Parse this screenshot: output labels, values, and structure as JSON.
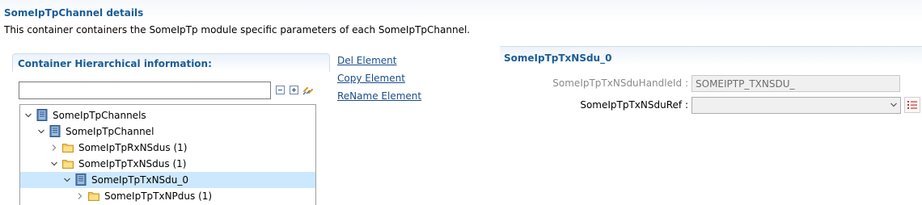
{
  "page": {
    "title": "SomeIpTpChannel details",
    "description": "This container containers the SomeIpTp module specific parameters of each SomeIpTpChannel."
  },
  "hierarchy": {
    "title": "Container Hierarchical information:",
    "filter_value": "",
    "tools": [
      "collapse-all-icon",
      "expand-all-icon",
      "link-with-editor-icon"
    ]
  },
  "tree": [
    {
      "label": "SomeIpTpChannels",
      "icon": "container-icon",
      "expanded": true,
      "level": 0
    },
    {
      "label": "SomeIpTpChannel",
      "icon": "container-icon",
      "expanded": true,
      "level": 1
    },
    {
      "label": "SomeIpTpRxNSdus (1)",
      "icon": "folder-icon",
      "expanded": false,
      "level": 2
    },
    {
      "label": "SomeIpTpTxNSdus (1)",
      "icon": "folder-icon",
      "expanded": true,
      "level": 2
    },
    {
      "label": "SomeIpTpTxNSdu_0",
      "icon": "container-icon",
      "expanded": true,
      "level": 3,
      "selected": true
    },
    {
      "label": "SomeIpTpTxNPdus (1)",
      "icon": "folder-icon",
      "expanded": false,
      "level": 4
    }
  ],
  "actions": {
    "del": "Del Element",
    "copy": "Copy Element",
    "rename": "ReName Element"
  },
  "detail": {
    "title": "SomeIpTpTxNSdu_0",
    "handle_label": "SomeIpTpTxNSduHandleId :",
    "handle_value": "SOMEIPTP_TXNSDU_",
    "ref_label": "SomeIpTpTxNSduRef :",
    "ref_value": ""
  },
  "colors": {
    "accent": "#1a5d97",
    "selection": "#cce8ff",
    "link": "#1a4c8a",
    "folder": "#f3c75a"
  }
}
